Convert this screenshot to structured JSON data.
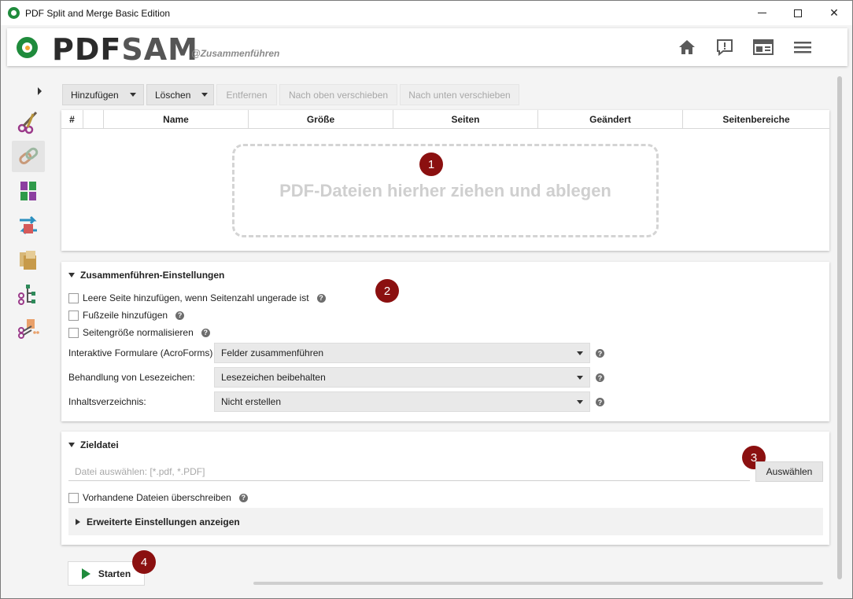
{
  "window": {
    "title": "PDF Split and Merge Basic Edition",
    "minimize_label": "",
    "close_label": "✕"
  },
  "header": {
    "logo_left": "PDF",
    "logo_right": "SAM",
    "subtitle": "@Zusammenführen",
    "icons": [
      "home-icon",
      "feedback-icon",
      "news-icon",
      "menu-icon"
    ]
  },
  "leftnav": {
    "items": [
      "split-icon",
      "merge-icon",
      "alternate-mix-icon",
      "rotate-icon",
      "extract-icon",
      "split-by-bookmarks-icon",
      "split-by-size-icon"
    ],
    "active_index": 1
  },
  "toolbar": {
    "add_label": "Hinzufügen",
    "clear_label": "Löschen",
    "remove_label": "Entfernen",
    "move_up_label": "Nach oben verschieben",
    "move_down_label": "Nach unten verschieben"
  },
  "table": {
    "columns": [
      "#",
      "",
      "Name",
      "Größe",
      "Seiten",
      "Geändert",
      "Seitenbereiche"
    ],
    "dropzone_text": "PDF-Dateien hierher ziehen und ablegen"
  },
  "badges": [
    "1",
    "2",
    "3",
    "4"
  ],
  "settings": {
    "title": "Zusammenführen-Einstellungen",
    "checkboxes": [
      "Leere Seite hinzufügen, wenn Seitenzahl ungerade ist",
      "Fußzeile hinzufügen",
      "Seitengröße normalisieren"
    ],
    "forms_label": "Interaktive Formulare (AcroForms)",
    "forms_value": "Felder zusammenführen",
    "bookmarks_label": "Behandlung von Lesezeichen:",
    "bookmarks_value": "Lesezeichen beibehalten",
    "toc_label": "Inhaltsverzeichnis:",
    "toc_value": "Nicht erstellen",
    "help_glyph": "?"
  },
  "destination": {
    "title": "Zieldatei",
    "placeholder": "Datei auswählen: [*.pdf, *.PDF]",
    "value": "",
    "browse_label": "Auswählen",
    "overwrite_label": "Vorhandene Dateien überschreiben",
    "advanced_label": "Erweiterte Einstellungen anzeigen"
  },
  "footer": {
    "start_label": "Starten"
  },
  "colors": {
    "brand_green": "#1f8b3c",
    "badge_red": "#8b1010"
  }
}
